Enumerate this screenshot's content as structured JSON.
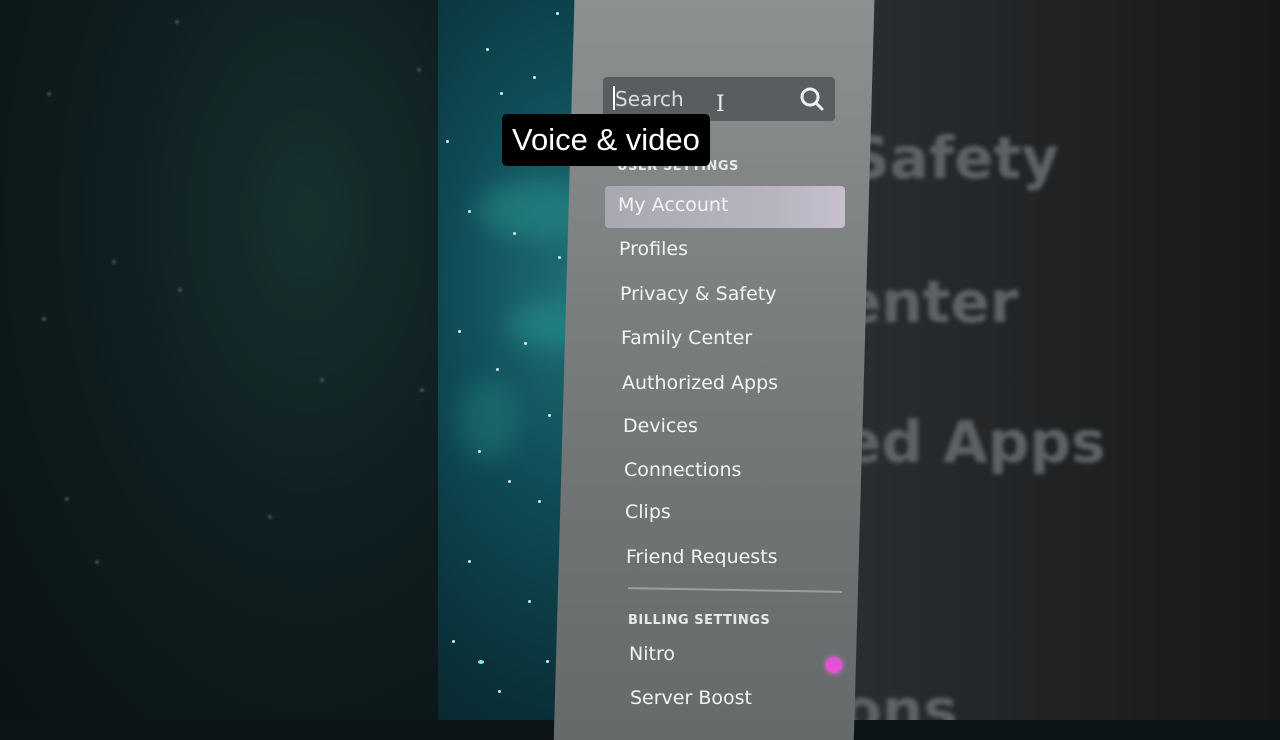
{
  "caption": "Voice & video",
  "search": {
    "placeholder": "Search"
  },
  "sections": {
    "user_settings": "USER SETTINGS",
    "billing_settings": "BILLING SETTINGS"
  },
  "nav_items": [
    {
      "label": "My Account",
      "active": true
    },
    {
      "label": "Profiles"
    },
    {
      "label": "Privacy & Safety"
    },
    {
      "label": "Family Center"
    },
    {
      "label": "Authorized Apps"
    },
    {
      "label": "Devices"
    },
    {
      "label": "Connections"
    },
    {
      "label": "Clips"
    },
    {
      "label": "Friend Requests"
    }
  ],
  "billing_items": [
    {
      "label": "Nitro"
    },
    {
      "label": "Server Boost"
    }
  ],
  "background_text": [
    "Safety",
    "enter",
    "ed Apps",
    "ons"
  ],
  "colors": {
    "sidebar": "#7e8282",
    "active_item": "#b7b4bf",
    "nitro_badge": "#e64fd6"
  }
}
